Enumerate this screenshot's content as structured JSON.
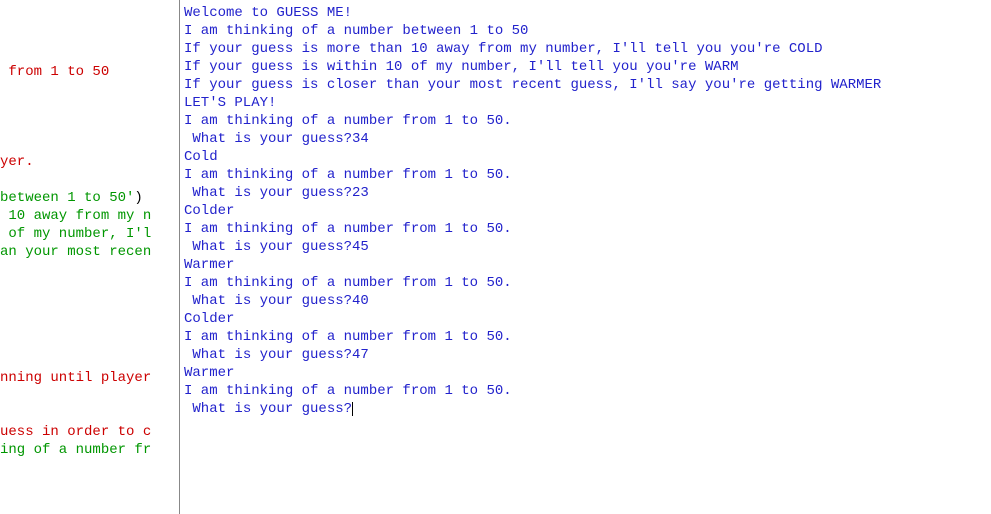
{
  "editor": {
    "lines": [
      {
        "segments": [
          {
            "text": " from 1 to 50",
            "cls": "c-red"
          }
        ]
      },
      {
        "segments": []
      },
      {
        "segments": []
      },
      {
        "segments": []
      },
      {
        "segments": []
      },
      {
        "segments": [
          {
            "text": "yer.",
            "cls": "c-red"
          }
        ]
      },
      {
        "segments": []
      },
      {
        "segments": [
          {
            "text": "between 1 to 50'",
            "cls": "c-green"
          },
          {
            "text": ")",
            "cls": "c-black"
          }
        ]
      },
      {
        "segments": [
          {
            "text": " 10 away from my n",
            "cls": "c-green"
          }
        ]
      },
      {
        "segments": [
          {
            "text": " of my number, I'l",
            "cls": "c-green"
          }
        ]
      },
      {
        "segments": [
          {
            "text": "an your most recen",
            "cls": "c-green"
          }
        ]
      },
      {
        "segments": []
      },
      {
        "segments": []
      },
      {
        "segments": []
      },
      {
        "segments": []
      },
      {
        "segments": []
      },
      {
        "segments": []
      },
      {
        "segments": [
          {
            "text": "nning until player",
            "cls": "c-red"
          }
        ]
      },
      {
        "segments": []
      },
      {
        "segments": []
      },
      {
        "segments": [
          {
            "text": "uess in order to c",
            "cls": "c-red"
          }
        ]
      },
      {
        "segments": [
          {
            "text": "ing of a number fr",
            "cls": "c-green"
          }
        ]
      }
    ]
  },
  "output": {
    "lines": [
      "Welcome to GUESS ME!",
      "I am thinking of a number between 1 to 50",
      "If your guess is more than 10 away from my number, I'll tell you you're COLD",
      "If your guess is within 10 of my number, I'll tell you you're WARM",
      "If your guess is closer than your most recent guess, I'll say you're getting WARMER",
      "LET'S PLAY!",
      "I am thinking of a number from 1 to 50.",
      " What is your guess?34",
      "Cold",
      "I am thinking of a number from 1 to 50.",
      " What is your guess?23",
      "Colder",
      "I am thinking of a number from 1 to 50.",
      " What is your guess?45",
      "Warmer",
      "I am thinking of a number from 1 to 50.",
      " What is your guess?40",
      "Colder",
      "I am thinking of a number from 1 to 50.",
      " What is your guess?47",
      "Warmer",
      "I am thinking of a number from 1 to 50."
    ],
    "prompt_last": " What is your guess?"
  }
}
